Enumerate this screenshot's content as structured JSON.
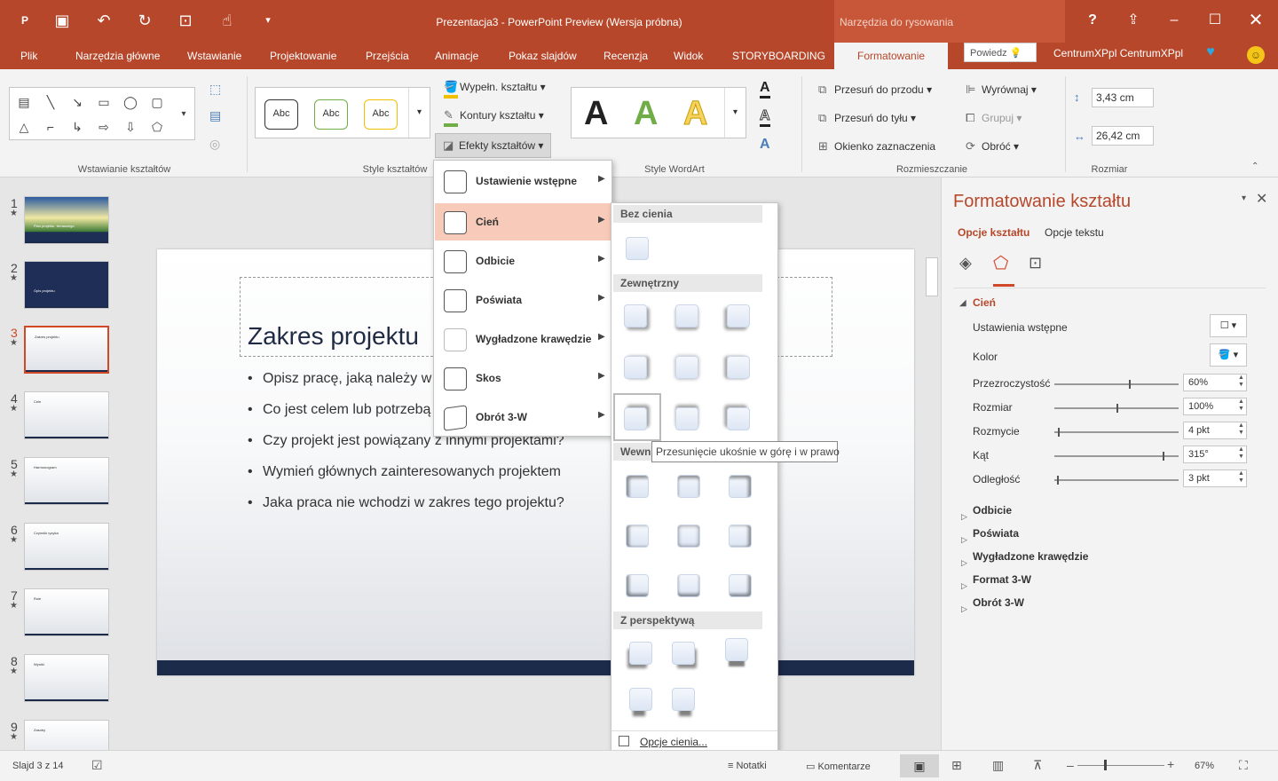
{
  "window": {
    "title": "Prezentacja3 - PowerPoint Preview (Wersja próbna)",
    "context_tab_group": "Narzędzia do rysowania",
    "user": "CentrumXPpl CentrumXPpl",
    "tell_me_placeholder": "Powiedz"
  },
  "tabs": [
    "Plik",
    "Narzędzia główne",
    "Wstawianie",
    "Projektowanie",
    "Przejścia",
    "Animacje",
    "Pokaz slajdów",
    "Recenzja",
    "Widok",
    "STORYBOARDING",
    "Formatowanie"
  ],
  "ribbon": {
    "groups": {
      "insert_shapes": "Wstawianie kształtów",
      "shape_styles": "Style kształtów",
      "wordart_styles": "Style WordArt",
      "arrange": "Rozmieszczanie",
      "size": "Rozmiar"
    },
    "style_samples": [
      "Abc",
      "Abc",
      "Abc"
    ],
    "fill": "Wypełn. kształtu",
    "outline": "Kontury kształtu",
    "effects": "Efekty kształtów",
    "wordart_letter": "A",
    "bring_forward": "Przesuń do przodu",
    "send_backward": "Przesuń do tyłu",
    "selection_pane": "Okienko zaznaczenia",
    "align": "Wyrównaj",
    "group": "Grupuj",
    "rotate": "Obróć",
    "height": "3,43 cm",
    "width": "26,42 cm"
  },
  "effects_menu": [
    {
      "label": "Ustawienie wstępne",
      "highlighted": false
    },
    {
      "label": "Cień",
      "highlighted": true
    },
    {
      "label": "Odbicie",
      "highlighted": false
    },
    {
      "label": "Poświata",
      "highlighted": false
    },
    {
      "label": "Wygładzone krawędzie",
      "highlighted": false
    },
    {
      "label": "Skos",
      "highlighted": false
    },
    {
      "label": "Obrót 3-W",
      "highlighted": false
    }
  ],
  "shadow_gallery": {
    "no_shadow": "Bez cienia",
    "outer": "Zewnętrzny",
    "inner": "Wewn",
    "perspective": "Z perspektywą",
    "options": "Opcje cienia...",
    "tooltip": "Przesunięcie ukośnie w górę i w prawo"
  },
  "slides": {
    "thumbnail_count": 9,
    "selected": 3,
    "thumb_texts": [
      "Plan projektu ·terraswego",
      "Opis projektu",
      "Zakres projektu",
      "Cele",
      "Harmonogram",
      "Czynniki ryzyka",
      "Role",
      "Wyniki",
      "Zasoby"
    ]
  },
  "slide": {
    "title": "Zakres projektu",
    "bullets": [
      "Opisz pracę, jaką należy w",
      "Co jest celem lub potrzebą",
      "Czy projekt jest powiązany z innymi projektami?",
      "Wymień głównych zainteresowanych projektem",
      "Jaka praca nie wchodzi w zakres tego projektu?"
    ]
  },
  "format_pane": {
    "title": "Formatowanie kształtu",
    "tab_shape": "Opcje kształtu",
    "tab_text": "Opcje tekstu",
    "section": "Cień",
    "presets": "Ustawienia wstępne",
    "color": "Kolor",
    "rows": [
      {
        "label": "Przezroczystość",
        "value": "60%",
        "level": 0.6
      },
      {
        "label": "Rozmiar",
        "value": "100%",
        "level": 0.5
      },
      {
        "label": "Rozmycie",
        "value": "4 pkt",
        "level": 0.03
      },
      {
        "label": "Kąt",
        "value": "315°",
        "level": 0.87
      },
      {
        "label": "Odległość",
        "value": "3 pkt",
        "level": 0.02
      }
    ],
    "sections": [
      "Odbicie",
      "Poświata",
      "Wygładzone krawędzie",
      "Format 3-W",
      "Obrót 3-W"
    ]
  },
  "status": {
    "slide_info": "Slajd 3 z 14",
    "notes": "Notatki",
    "comments": "Komentarze",
    "zoom": "67%"
  }
}
